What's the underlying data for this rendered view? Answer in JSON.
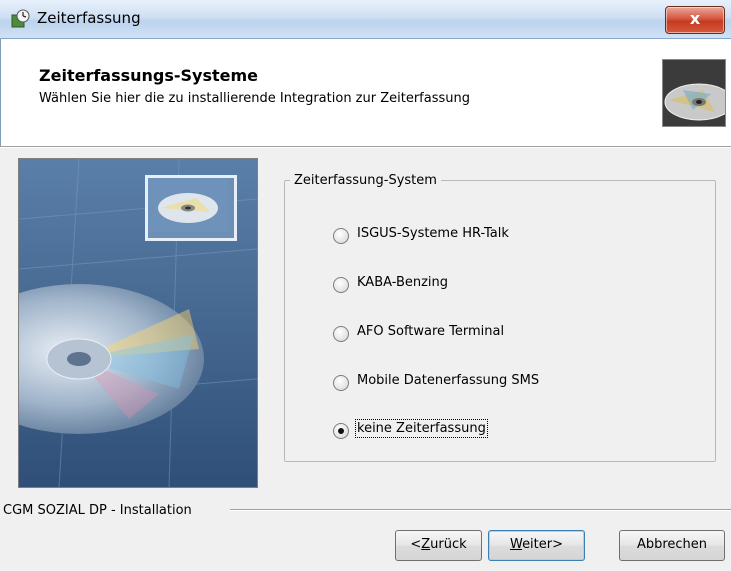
{
  "window": {
    "title": "Zeiterfassung",
    "close_label": "x"
  },
  "header": {
    "title": "Zeiterfassungs-Systeme",
    "subtitle": "Wählen Sie hier die zu installierende Integration zur Zeiterfassung"
  },
  "group": {
    "legend": "Zeiterfassung-System",
    "options": [
      {
        "label": "ISGUS-Systeme HR-Talk",
        "checked": false
      },
      {
        "label": "KABA-Benzing",
        "checked": false
      },
      {
        "label": "AFO Software Terminal",
        "checked": false
      },
      {
        "label": "Mobile Datenerfassung SMS",
        "checked": false
      },
      {
        "label": "keine Zeiterfassung",
        "checked": true
      }
    ]
  },
  "footer": {
    "label": "CGM SOZIAL DP - Installation",
    "back_prefix": "<",
    "back_mnemonic": "Z",
    "back_rest": "urück",
    "next_mnemonic": "W",
    "next_rest": "eiter>",
    "cancel": "Abbrechen"
  },
  "icons": {
    "title_icon": "installer-clock-icon",
    "header_icon": "cd-disc-icon",
    "side_image": "cd-banner-image"
  }
}
